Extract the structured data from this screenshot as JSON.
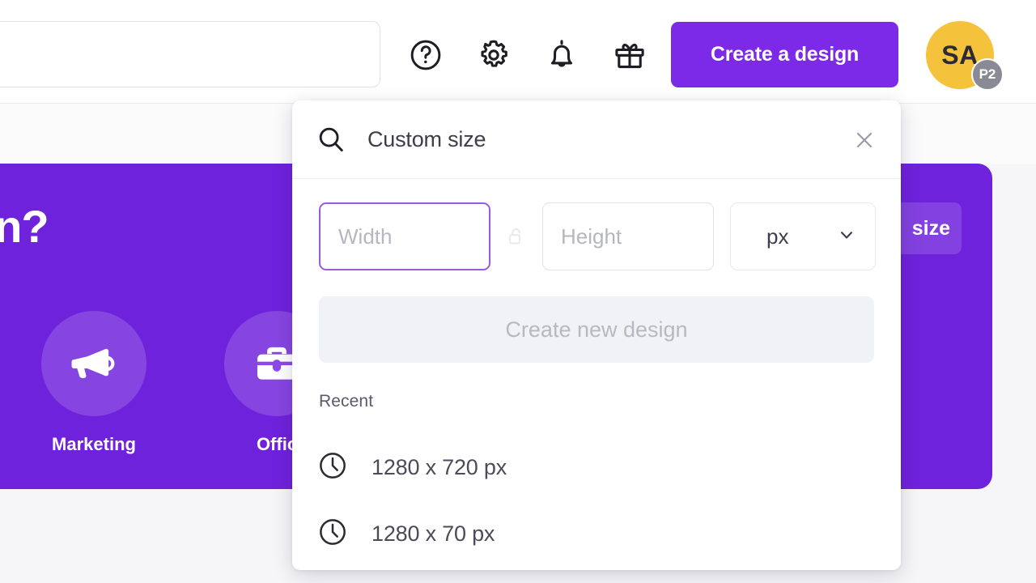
{
  "topbar": {
    "search": {
      "placeholder": "",
      "value": ""
    },
    "icons": [
      {
        "name": "help-icon",
        "label": "Help"
      },
      {
        "name": "settings-gear-icon",
        "label": "Settings"
      },
      {
        "name": "notifications-bell-icon",
        "label": "Notifications"
      },
      {
        "name": "gift-icon",
        "label": "Gift"
      }
    ],
    "create_design_label": "Create a design",
    "avatar": {
      "initials": "SA",
      "badge": "P2"
    }
  },
  "hero": {
    "title": "gn?",
    "size_button_label": "size",
    "categories": [
      {
        "icon": "megaphone-icon",
        "label": "Marketing"
      },
      {
        "icon": "briefcase-icon",
        "label": "Offic"
      }
    ]
  },
  "modal": {
    "title": "Custom size",
    "close_label": "×",
    "width_input": {
      "placeholder": "Width",
      "value": ""
    },
    "height_input": {
      "placeholder": "Height",
      "value": ""
    },
    "unit": {
      "value": "px"
    },
    "create_button_label": "Create new design",
    "recent_label": "Recent",
    "recent_items": [
      {
        "label": "1280 x 720 px"
      },
      {
        "label": "1280 x 70 px"
      }
    ]
  },
  "colors": {
    "brand_purple": "#7d2ae8",
    "hero_purple": "#6f22dc",
    "avatar_yellow": "#f5c33b",
    "badge_gray": "#8a8a94",
    "focus_border": "#9a5be0"
  }
}
